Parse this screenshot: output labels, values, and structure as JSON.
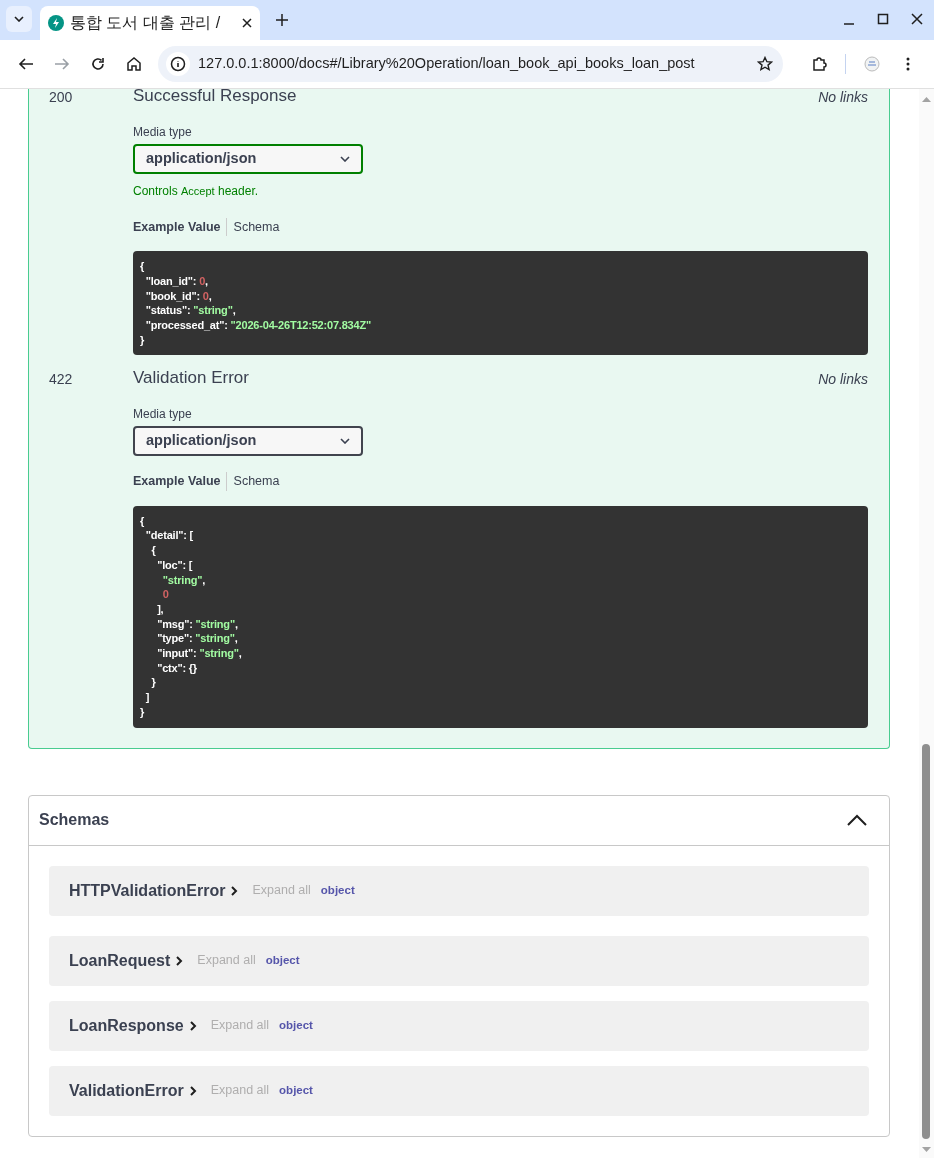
{
  "browser": {
    "tab_title": "통합 도서 대출 관리 /",
    "url": "127.0.0.1:8000/docs#/Library%20Operation/loan_book_api_books_loan_post"
  },
  "responses": [
    {
      "code": "200",
      "description": "Successful Response",
      "links": "No links",
      "media_type_label": "Media type",
      "media_type": "application/json",
      "focused": true,
      "controls_note": {
        "before": "Controls",
        "code": "Accept",
        "after": "header."
      },
      "example_tab": "Example Value",
      "schema_tab": "Schema",
      "example_lines": [
        "{",
        "  \"loan_id\": 0,",
        "  \"book_id\": 0,",
        "  \"status\": \"string\",",
        "  \"processed_at\": \"2026-04-26T12:52:07.834Z\"",
        "}"
      ]
    },
    {
      "code": "422",
      "description": "Validation Error",
      "links": "No links",
      "media_type_label": "Media type",
      "media_type": "application/json",
      "focused": false,
      "example_tab": "Example Value",
      "schema_tab": "Schema",
      "example_lines": [
        "{",
        "  \"detail\": [",
        "    {",
        "      \"loc\": [",
        "        \"string\",",
        "        0",
        "      ],",
        "      \"msg\": \"string\",",
        "      \"type\": \"string\",",
        "      \"input\": \"string\",",
        "      \"ctx\": {}",
        "    }",
        "  ]",
        "}"
      ]
    }
  ],
  "schemas": {
    "title": "Schemas",
    "expanded": true,
    "items": [
      {
        "name": "HTTPValidationError",
        "expand_all": "Expand all",
        "type": "object"
      },
      {
        "name": "LoanRequest",
        "expand_all": "Expand all",
        "type": "object"
      },
      {
        "name": "LoanResponse",
        "expand_all": "Expand all",
        "type": "object"
      },
      {
        "name": "ValidationError",
        "expand_all": "Expand all",
        "type": "object"
      }
    ]
  }
}
